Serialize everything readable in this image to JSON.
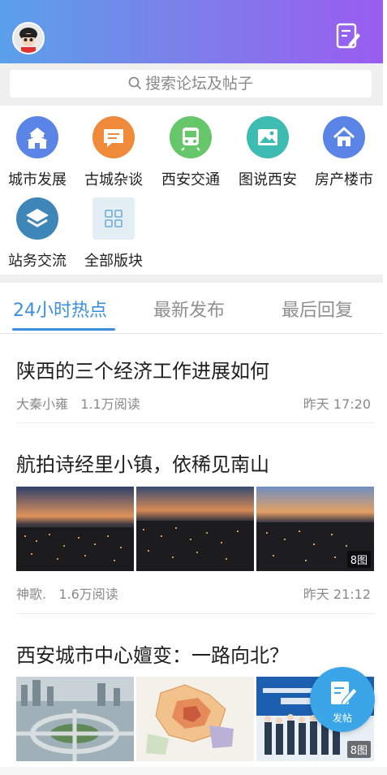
{
  "header": {
    "avatar_icon": "avatar-icon",
    "compose_icon": "edit-note-icon",
    "gradient": [
      "#5aa0ea",
      "#9a5cf0"
    ]
  },
  "search": {
    "placeholder": "搜索论坛及帖子"
  },
  "categories": [
    {
      "label": "城市发展",
      "icon": "city-gate-icon",
      "color": "#5a84e6"
    },
    {
      "label": "古城杂谈",
      "icon": "chat-bubble-icon",
      "color": "#ee8a3a"
    },
    {
      "label": "西安交通",
      "icon": "train-icon",
      "color": "#66c66a"
    },
    {
      "label": "图说西安",
      "icon": "picture-icon",
      "color": "#3fbcb1"
    },
    {
      "label": "房产楼市",
      "icon": "house-icon",
      "color": "#5a84e6"
    },
    {
      "label": "站务交流",
      "icon": "layers-icon",
      "color": "#3f86b8"
    },
    {
      "label": "全部版块",
      "icon": "grid-icon",
      "color": "#e3eef5"
    }
  ],
  "tabs": [
    {
      "label": "24小时热点",
      "active": true
    },
    {
      "label": "最新发布",
      "active": false
    },
    {
      "label": "最后回复",
      "active": false
    }
  ],
  "posts": [
    {
      "title": "陕西的三个经济工作进展如何",
      "author": "大秦小雍",
      "reads": "1.1万阅读",
      "time": "昨天 17:20"
    },
    {
      "title": "航拍诗经里小镇，依稀见南山",
      "author": "神歌.",
      "reads": "1.6万阅读",
      "time": "昨天 21:12",
      "image_badge": "8图"
    },
    {
      "title": "西安城市中心嬗变：一路向北？",
      "image_badge": "8图"
    }
  ],
  "fab": {
    "label": "发帖",
    "color": "#3aa6e8"
  }
}
